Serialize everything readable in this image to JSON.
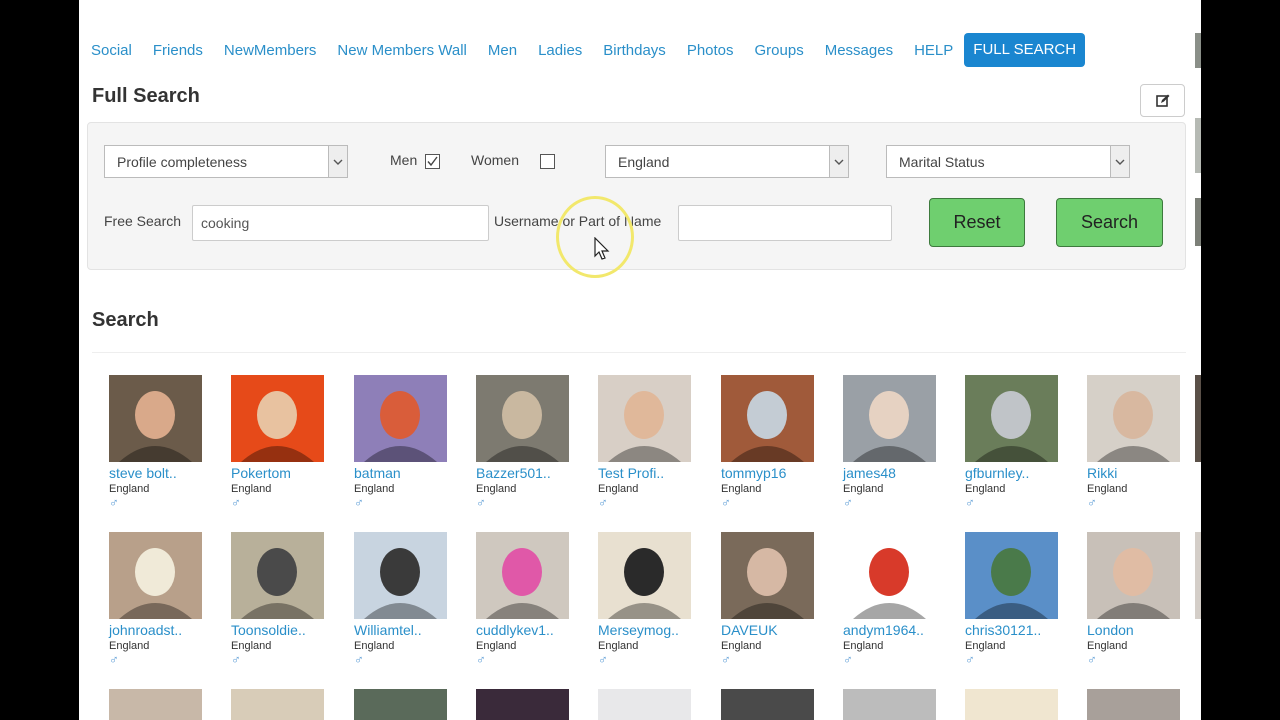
{
  "nav": [
    "Social",
    "Friends",
    "NewMembers",
    "New Members Wall",
    "Men",
    "Ladies",
    "Birthdays",
    "Photos",
    "Groups",
    "Messages",
    "HELP",
    "FULL SEARCH"
  ],
  "page_title": "Full Search",
  "filters": {
    "profile_select": "Profile completeness",
    "men_label": "Men",
    "men_checked": true,
    "women_label": "Women",
    "women_checked": false,
    "country_select": "England",
    "marital_select": "Marital Status",
    "free_search_label": "Free Search",
    "free_search_value": "cooking",
    "username_label": "Username or Part of Name",
    "username_value": "",
    "reset_label": "Reset",
    "search_label": "Search"
  },
  "results_title": "Search",
  "gender_icon": "male-symbol-icon",
  "members": [
    {
      "name": "steve bolt..",
      "location": "England",
      "bg": "#6b5b4a",
      "face": "#d9a98a"
    },
    {
      "name": "Pokertom",
      "location": "England",
      "bg": "#e64a19",
      "face": "#e8c2a0"
    },
    {
      "name": "batman",
      "location": "England",
      "bg": "#8e7fb8",
      "face": "#d95d3a"
    },
    {
      "name": "Bazzer501..",
      "location": "England",
      "bg": "#7d7a70",
      "face": "#c9b8a0"
    },
    {
      "name": "Test Profi..",
      "location": "England",
      "bg": "#d8cfc6",
      "face": "#e0b89a"
    },
    {
      "name": "tommyp16",
      "location": "England",
      "bg": "#a05a3a",
      "face": "#c4ccd4"
    },
    {
      "name": "james48",
      "location": "England",
      "bg": "#9aa0a6",
      "face": "#e6d2c2"
    },
    {
      "name": "gfburnley..",
      "location": "England",
      "bg": "#6a7d5a",
      "face": "#c0c4c8"
    },
    {
      "name": "Rikki",
      "location": "England",
      "bg": "#d6d0c8",
      "face": "#d8b8a0"
    },
    {
      "name": "johnroadst..",
      "location": "England",
      "bg": "#b8a08a",
      "face": "#f0ead8"
    },
    {
      "name": "Toonsoldie..",
      "location": "England",
      "bg": "#b8b09a",
      "face": "#4a4a4a"
    },
    {
      "name": "Williamtel..",
      "location": "England",
      "bg": "#c8d4e0",
      "face": "#3a3a3a"
    },
    {
      "name": "cuddlykev1..",
      "location": "England",
      "bg": "#cfc8bf",
      "face": "#e058a8"
    },
    {
      "name": "Merseymog..",
      "location": "England",
      "bg": "#e8e0d0",
      "face": "#2a2a2a"
    },
    {
      "name": "DAVEUK",
      "location": "England",
      "bg": "#7a6a5a",
      "face": "#d6b8a4"
    },
    {
      "name": "andym1964..",
      "location": "England",
      "bg": "#ffffff",
      "face": "#d83a2a"
    },
    {
      "name": "chris30121..",
      "location": "England",
      "bg": "#5a8fc8",
      "face": "#4a7a4a"
    },
    {
      "name": "London",
      "location": "England",
      "bg": "#c8c0b8",
      "face": "#e0bca4"
    }
  ],
  "partial_row_colors": [
    "#c8b8a8",
    "#d8ccb8",
    "#5a6a5a",
    "#3a2a3a",
    "#e8e8ea",
    "#4a4a4a",
    "#bcbcbc",
    "#f0e6d0",
    "#a8a09a"
  ]
}
